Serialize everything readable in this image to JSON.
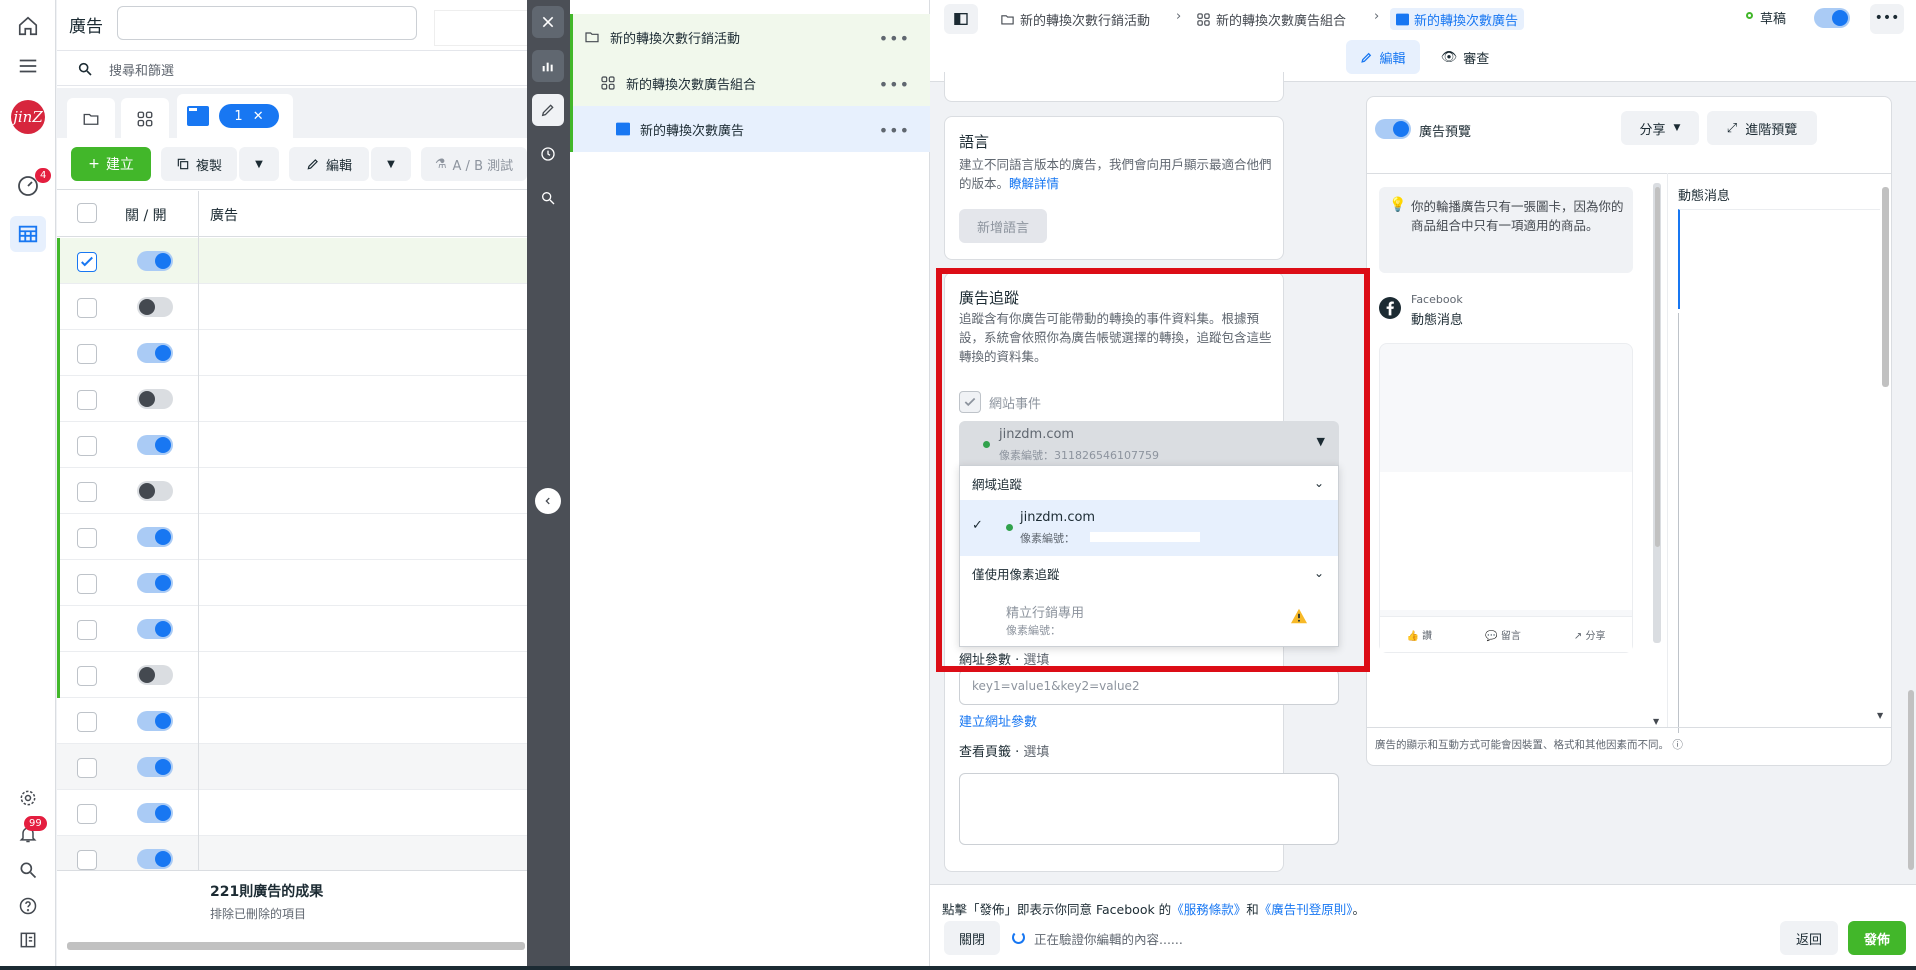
{
  "left_nav": {
    "notif_badge": "4",
    "bell_badge": "99",
    "logo_text": "jinZ"
  },
  "ads_manager": {
    "title": "廣告",
    "search_placeholder": "搜尋和篩選",
    "selected_tab_count": "1",
    "create_label": "建立",
    "copy_label": "複製",
    "edit_label": "編輯",
    "ab_test_label": "A / B 測試",
    "col_toggle": "關 / 開",
    "col_ad": "廣告",
    "row_states": [
      true,
      false,
      true,
      false,
      true,
      false,
      true,
      true,
      true,
      false,
      true,
      true,
      true,
      true
    ],
    "footer_results": "221則廣告的成果",
    "footer_sub": "排除已刪除的項目"
  },
  "tree": {
    "campaign": "新的轉換次數行銷活動",
    "adset": "新的轉換次數廣告組合",
    "ad": "新的轉換次數廣告"
  },
  "editor": {
    "breadcrumbs": [
      "新的轉換次數行銷活動",
      "新的轉換次數廣告組合",
      "新的轉換次數廣告"
    ],
    "status": "草稿",
    "tab_edit": "編輯",
    "tab_review": "審查",
    "language": {
      "title": "語言",
      "desc": "建立不同語言版本的廣告，我們會向用戶顯示最適合他們的版本。",
      "link": "瞭解詳情",
      "add_button": "新增語言"
    },
    "tracking": {
      "title": "廣告追蹤",
      "desc": "追蹤含有你廣告可能帶動的轉換的事件資料集。根據預設，系統會依照你為廣告帳號選擇的轉換，追蹤包含這些轉換的資料集。",
      "website_events_label": "網站事件",
      "selected_domain": "jinzdm.com",
      "selected_pixel": "像素編號：311826546107759",
      "section_domain_tracking": "網域追蹤",
      "option_domain": "jinzdm.com",
      "option_pixel": "像素編號：",
      "section_pixel_only": "僅使用像素追蹤",
      "option2_name": "精立行銷專用",
      "option2_pixel": "像素編號："
    },
    "url_params": {
      "label": "網址參數",
      "optional": "選填",
      "placeholder": "key1=value1&key2=value2",
      "build_link": "建立網址參數"
    },
    "view_tags": {
      "label": "查看頁籤",
      "optional": "選填"
    },
    "preview": {
      "toggle_label": "廣告預覽",
      "share": "分享",
      "advanced": "進階預覽",
      "tip": "你的輪播廣告只有一張圖卡，因為你的商品組合中只有一項適用的商品。",
      "placement_brand": "Facebook",
      "placement_name": "動態消息",
      "right_title": "動態消息",
      "like": "讚",
      "comment": "留言",
      "share_action": "分享",
      "disclaimer": "廣告的顯示和互動方式可能會因裝置、格式和其他因素而不同。"
    },
    "footer": {
      "terms_prefix": "點擊「發佈」即表示你同意 Facebook 的",
      "terms_link1": "《服務條款》",
      "terms_mid": "和",
      "terms_link2": "《廣告刊登原則》",
      "terms_suffix": "。",
      "close": "關閉",
      "verifying": "正在驗證你編輯的內容......",
      "back": "返回",
      "publish": "發佈"
    }
  },
  "colors": {
    "accent": "#1877f2",
    "green": "#42b72a",
    "highlight_red": "#dc0d16"
  }
}
